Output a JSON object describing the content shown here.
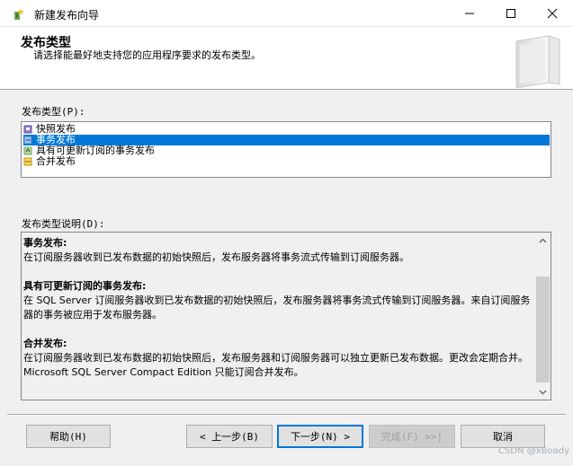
{
  "window": {
    "title": "新建发布向导",
    "icon": "wizard-icon",
    "controls": [
      "minimize-icon",
      "maximize-icon",
      "close-icon"
    ]
  },
  "header": {
    "title": "发布类型",
    "subtitle": "请选择能最好地支持您的应用程序要求的发布类型。",
    "icon": "book-icon"
  },
  "publication_types": {
    "label": "发布类型(P):",
    "items": [
      {
        "label": "快照发布",
        "icon": "snapshot-icon",
        "selected": false
      },
      {
        "label": "事务发布",
        "icon": "transaction-icon",
        "selected": true
      },
      {
        "label": "具有可更新订阅的事务发布",
        "icon": "updatable-icon",
        "selected": false
      },
      {
        "label": "合并发布",
        "icon": "merge-icon",
        "selected": false
      }
    ]
  },
  "description": {
    "label": "发布类型说明(D):",
    "sections": [
      {
        "heading": "事务发布:",
        "text": "在订阅服务器收到已发布数据的初始快照后，发布服务器将事务流式传输到订阅服务器。"
      },
      {
        "heading": "具有可更新订阅的事务发布:",
        "text": "在 SQL Server 订阅服务器收到已发布数据的初始快照后，发布服务器将事务流式传输到订阅服务器。来自订阅服务器的事务被应用于发布服务器。"
      },
      {
        "heading": "合并发布:",
        "text": "在订阅服务器收到已发布数据的初始快照后，发布服务器和订阅服务器可以独立更新已发布数据。更改会定期合并。Microsoft SQL Server Compact Edition 只能订阅合并发布。"
      }
    ]
  },
  "buttons": {
    "help": "帮助(H)",
    "back": "< 上一步(B)",
    "next": "下一步(N) >",
    "finish": "完成(F) >>|",
    "cancel": "取消"
  },
  "watermark": "CSDN @xBoady",
  "colors": {
    "selection": "#0078d7",
    "dialog_bg": "#f0f0f0",
    "header_bg": "#ffffff"
  }
}
